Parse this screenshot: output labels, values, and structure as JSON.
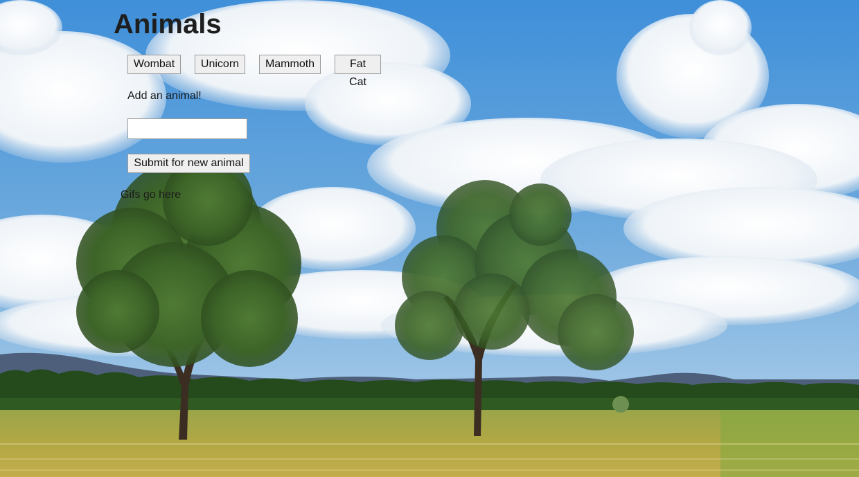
{
  "page": {
    "title": "Animals",
    "background": "landscape-photo"
  },
  "animal_buttons": [
    {
      "label": "Wombat"
    },
    {
      "label": "Unicorn"
    },
    {
      "label": "Mammoth"
    },
    {
      "label": "Fat Cat"
    }
  ],
  "form": {
    "prompt": "Add an animal!",
    "input_value": "",
    "submit_label": "Submit for new animal"
  },
  "gifs": {
    "placeholder_text": "Gifs go here"
  }
}
